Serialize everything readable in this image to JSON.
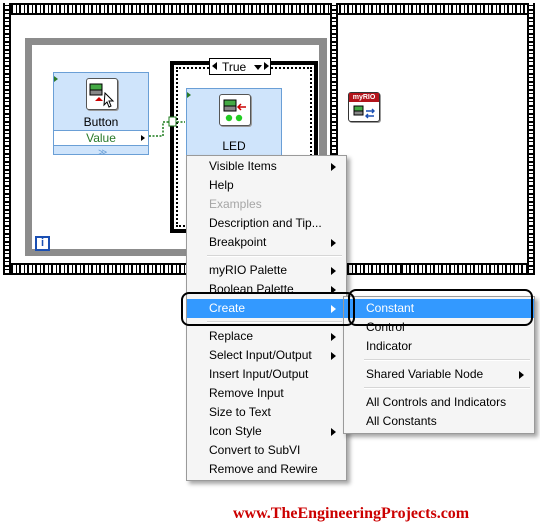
{
  "block_diagram": {
    "button_node": {
      "title": "Button",
      "terminal": "Value"
    },
    "led_node": {
      "title": "LED"
    },
    "case_selector": {
      "value": "True"
    },
    "loop_iteration": {
      "label": "i"
    },
    "myrio_badge": {
      "label": "myRIO"
    }
  },
  "context_menu": {
    "items": [
      {
        "label": "Visible Items",
        "submenu": true,
        "enabled": true
      },
      {
        "label": "Help",
        "submenu": false,
        "enabled": true
      },
      {
        "label": "Examples",
        "submenu": false,
        "enabled": false
      },
      {
        "label": "Description and Tip...",
        "submenu": false,
        "enabled": true
      },
      {
        "label": "Breakpoint",
        "submenu": true,
        "enabled": true
      },
      {
        "label": "myRIO Palette",
        "submenu": true,
        "enabled": true
      },
      {
        "label": "Boolean Palette",
        "submenu": true,
        "enabled": true
      },
      {
        "label": "Create",
        "submenu": true,
        "enabled": true,
        "highlighted": true
      },
      {
        "label": "Replace",
        "submenu": true,
        "enabled": true
      },
      {
        "label": "Select Input/Output",
        "submenu": true,
        "enabled": true
      },
      {
        "label": "Insert Input/Output",
        "submenu": false,
        "enabled": true
      },
      {
        "label": "Remove Input",
        "submenu": false,
        "enabled": true
      },
      {
        "label": "Size to Text",
        "submenu": false,
        "enabled": true
      },
      {
        "label": "Icon Style",
        "submenu": true,
        "enabled": true
      },
      {
        "label": "Convert to SubVI",
        "submenu": false,
        "enabled": true
      },
      {
        "label": "Remove and Rewire",
        "submenu": false,
        "enabled": true
      }
    ]
  },
  "create_submenu": {
    "items": [
      {
        "label": "Constant",
        "highlighted": true
      },
      {
        "label": "Control"
      },
      {
        "label": "Indicator"
      },
      {
        "label": "Shared Variable Node",
        "submenu": true
      },
      {
        "label": "All Controls and Indicators"
      },
      {
        "label": "All Constants"
      }
    ]
  },
  "watermark": {
    "text": "www.TheEngineeringProjects.com"
  },
  "colors": {
    "menu_highlight": "#3399ff",
    "watermark": "#cc0000",
    "node_fill": "#cfe4fb",
    "terminal_text": "#2a7a2a"
  }
}
